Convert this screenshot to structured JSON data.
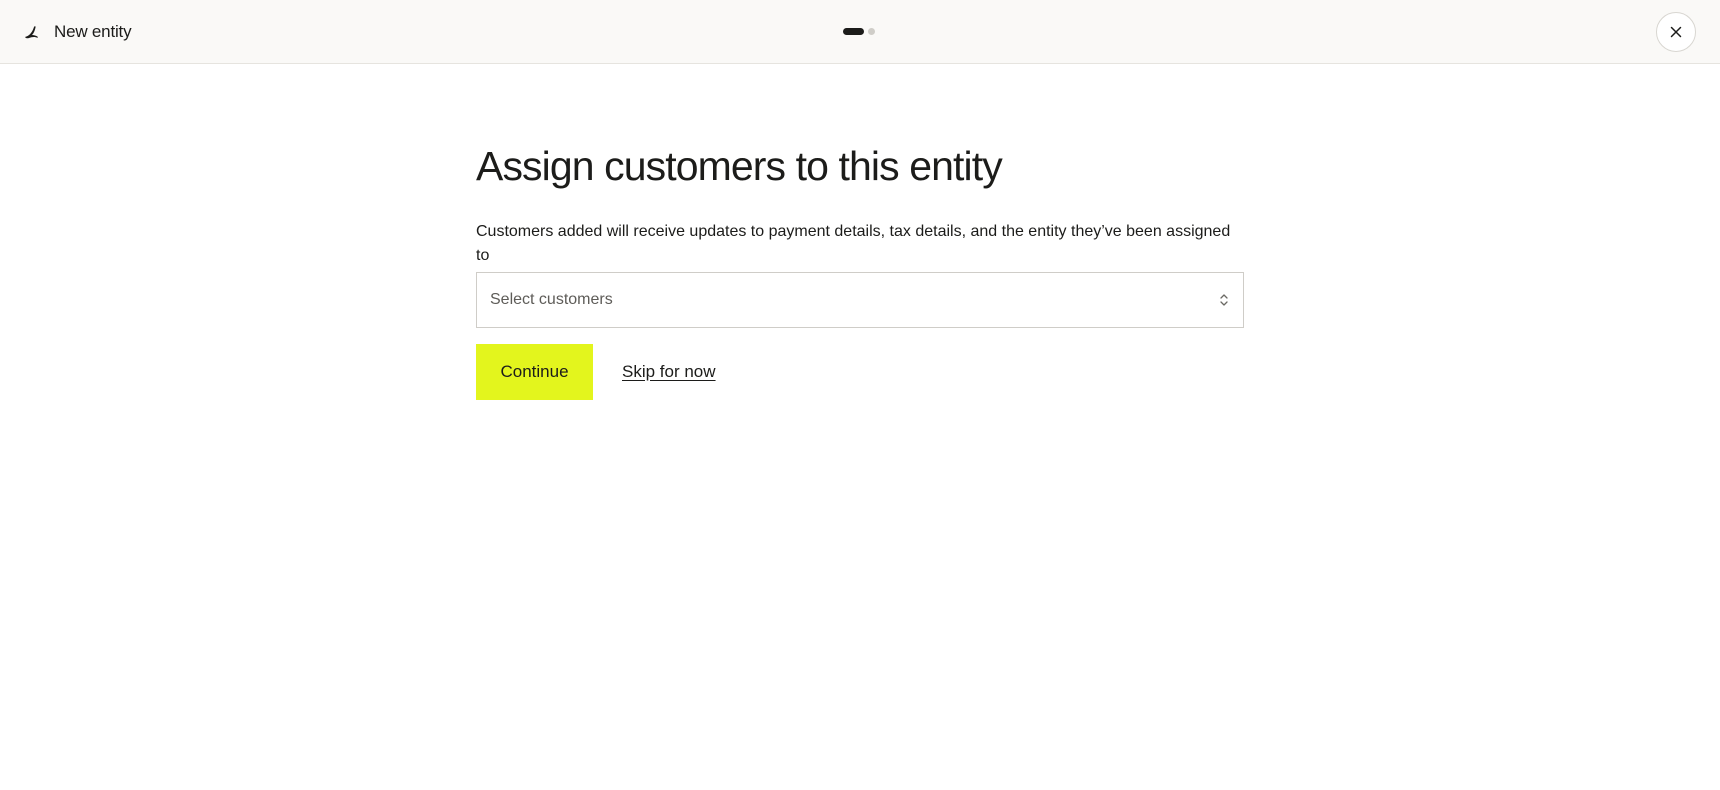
{
  "header": {
    "logo_icon": "bird-logo-icon",
    "title": "New entity",
    "stepper": {
      "current_step": 1,
      "total_steps": 2
    },
    "close_icon": "close-icon"
  },
  "main": {
    "title": "Assign customers to this entity",
    "description": "Customers added will receive updates to payment details, tax details, and the entity they’ve been assigned to",
    "customer_select": {
      "placeholder": "Select customers",
      "icon": "chevron-up-down-icon"
    },
    "continue_label": "Continue",
    "skip_label": "Skip for now"
  },
  "colors": {
    "primary_button": "#e3f51d",
    "text": "#1c1c1a",
    "header_background": "#faf9f7",
    "step_active": "#1c1c1a",
    "step_inactive": "#cfcdc8"
  }
}
